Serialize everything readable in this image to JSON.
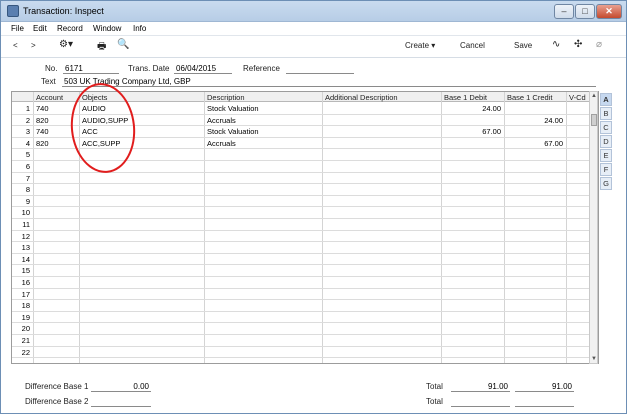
{
  "window": {
    "title": "Transaction: Inspect"
  },
  "menu": [
    "File",
    "Edit",
    "Record",
    "Window",
    "Info"
  ],
  "toolbar": {
    "create_label": "Create",
    "cancel_label": "Cancel",
    "save_label": "Save"
  },
  "form": {
    "no_label": "No.",
    "no_value": "6171",
    "date_label": "Trans. Date",
    "date_value": "06/04/2015",
    "reference_label": "Reference",
    "reference_value": "",
    "text_label": "Text",
    "text_value": "503 UK Trading Company Ltd, GBP"
  },
  "grid": {
    "columns": [
      "Account",
      "Objects",
      "Description",
      "Additional Description",
      "Base 1 Debit",
      "Base 1 Credit",
      "V-Cd"
    ],
    "rows": [
      {
        "n": "1",
        "account": "740",
        "objects": "AUDIO",
        "description": "Stock Valuation",
        "debit": "24.00",
        "credit": ""
      },
      {
        "n": "2",
        "account": "820",
        "objects": "AUDIO,SUPP",
        "description": "Accruals",
        "debit": "",
        "credit": "24.00"
      },
      {
        "n": "3",
        "account": "740",
        "objects": "ACC",
        "description": "Stock Valuation",
        "debit": "67.00",
        "credit": ""
      },
      {
        "n": "4",
        "account": "820",
        "objects": "ACC,SUPP",
        "description": "Accruals",
        "debit": "",
        "credit": "67.00"
      },
      {
        "n": "5"
      },
      {
        "n": "6"
      },
      {
        "n": "7"
      },
      {
        "n": "8"
      },
      {
        "n": "9"
      },
      {
        "n": "10"
      },
      {
        "n": "11"
      },
      {
        "n": "12"
      },
      {
        "n": "13"
      },
      {
        "n": "14"
      },
      {
        "n": "15"
      },
      {
        "n": "16"
      },
      {
        "n": "17"
      },
      {
        "n": "18"
      },
      {
        "n": "19"
      },
      {
        "n": "20"
      },
      {
        "n": "21"
      },
      {
        "n": "22"
      }
    ]
  },
  "tabs": [
    "A",
    "B",
    "C",
    "D",
    "E",
    "F",
    "G"
  ],
  "footer": {
    "diff1_label": "Difference Base 1",
    "diff1_value": "0.00",
    "diff2_label": "Difference Base 2",
    "diff2_value": "",
    "total_label": "Total",
    "total_debit": "91.00",
    "total_credit": "91.00",
    "total2_label": "Total",
    "total2_debit": "",
    "total2_credit": ""
  },
  "colors": {
    "annotation": "#e11d1d",
    "titlebar": "#c9dbef"
  }
}
